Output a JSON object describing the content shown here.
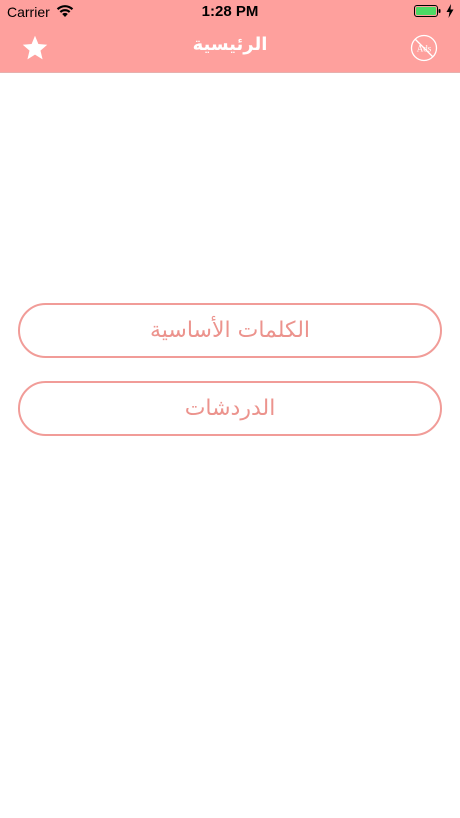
{
  "status_bar": {
    "carrier": "Carrier",
    "time": "1:28 PM",
    "wifi_icon": "wifi-icon",
    "battery_icon": "battery-icon",
    "charge_icon": "charging-bolt-icon",
    "battery_color": "#4cd964"
  },
  "nav": {
    "title": "الرئيسية",
    "left_icon": "star-icon",
    "right_icon": "no-ads-icon",
    "right_icon_text": "Ads",
    "background": "#fea09d"
  },
  "menu": {
    "items": [
      {
        "label": "الكلمات الأساسية"
      },
      {
        "label": "الدردشات"
      }
    ],
    "accent": "#ec938d"
  }
}
